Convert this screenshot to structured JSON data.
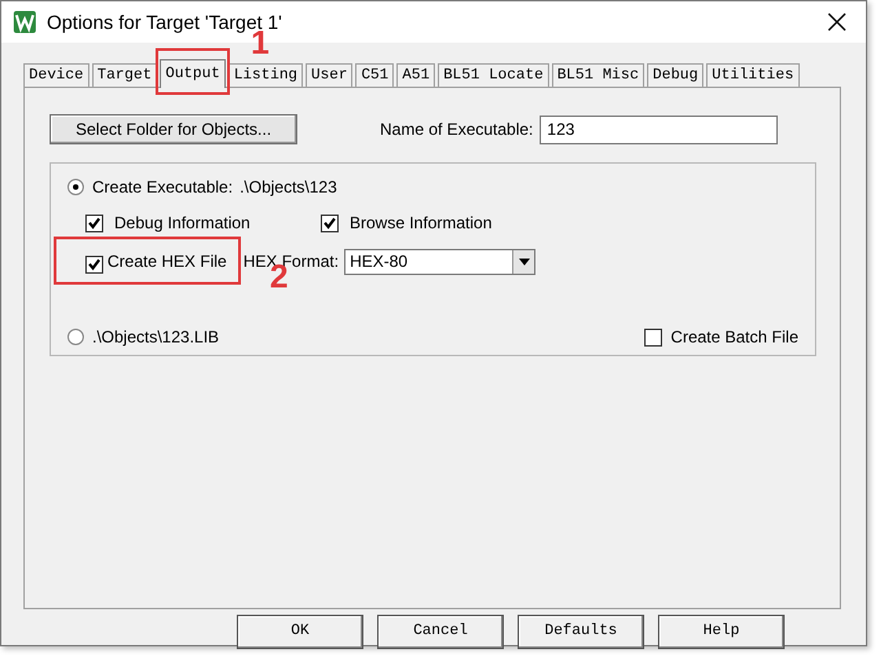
{
  "window": {
    "title": "Options for Target 'Target 1'"
  },
  "tabs": [
    {
      "label": "Device",
      "selected": false
    },
    {
      "label": "Target",
      "selected": false
    },
    {
      "label": "Output",
      "selected": true
    },
    {
      "label": "Listing",
      "selected": false
    },
    {
      "label": "User",
      "selected": false
    },
    {
      "label": "C51",
      "selected": false
    },
    {
      "label": "A51",
      "selected": false
    },
    {
      "label": "BL51 Locate",
      "selected": false
    },
    {
      "label": "BL51 Misc",
      "selected": false
    },
    {
      "label": "Debug",
      "selected": false
    },
    {
      "label": "Utilities",
      "selected": false
    }
  ],
  "select_folder_button": "Select Folder for Objects...",
  "name_of_executable": {
    "label": "Name of Executable:",
    "value": "123"
  },
  "create_executable": {
    "label": "Create Executable:",
    "path": ".\\Objects\\123",
    "selected": true
  },
  "debug_information": {
    "label": "Debug Information",
    "checked": true
  },
  "browse_information": {
    "label": "Browse Information",
    "checked": true
  },
  "create_hex_file": {
    "label": "Create HEX File",
    "checked": true
  },
  "hex_format": {
    "label": "HEX Format:",
    "value": "HEX-80"
  },
  "create_library": {
    "label": ".\\Objects\\123.LIB",
    "selected": false
  },
  "create_batch_file": {
    "label": "Create Batch File",
    "checked": false
  },
  "buttons": [
    "OK",
    "Cancel",
    "Defaults",
    "Help"
  ],
  "annotations": [
    {
      "label": "1"
    },
    {
      "label": "2"
    }
  ]
}
